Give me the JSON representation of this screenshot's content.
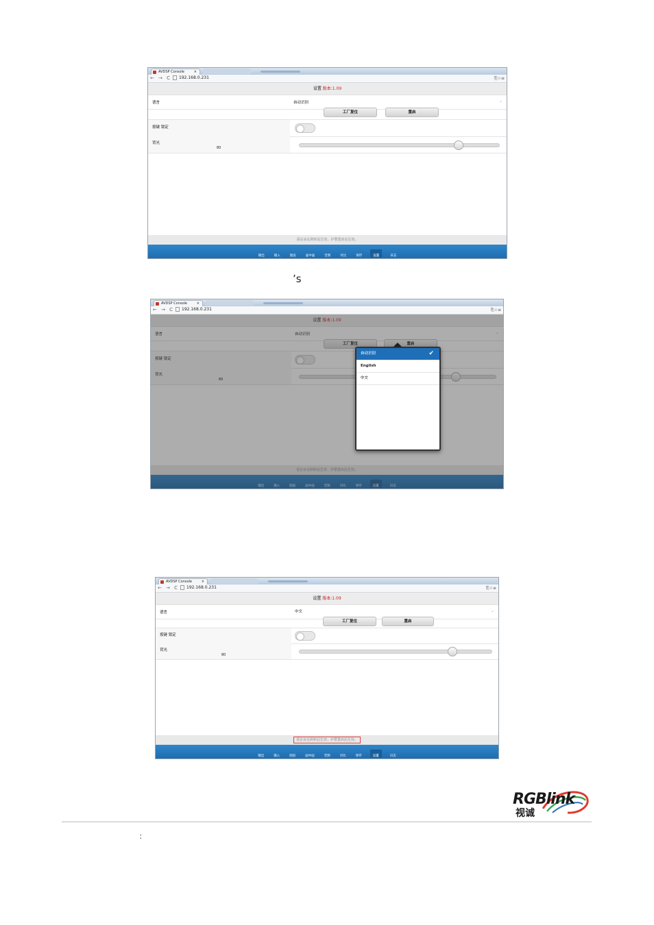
{
  "browser": {
    "tab_title": "AVDSP Console",
    "tab_close": "×",
    "nav_symbols": "← → C",
    "url": "192.168.0.231",
    "toolbar_symbols": "⎘☆≡"
  },
  "app": {
    "header_title": "设置",
    "header_version": "版本:1.09",
    "language_label": "语言",
    "language_value_auto": "自动识别",
    "language_value_cn": "中文",
    "factory_reset_label": "工厂复位",
    "restart_label": "重启",
    "key_lock_label": "按键 锁定",
    "backlight_label": "背光",
    "backlight_value": "80",
    "backlight_level": 0.8,
    "footer_hint": "语言会在刷新后生效，护要重启后生效。",
    "bottom_nav": [
      "输出",
      "输入",
      "图层",
      "画中画",
      "音频",
      "对比",
      "保存",
      "设置",
      "日志"
    ],
    "active_nav": "设置"
  },
  "language_popup": {
    "options": [
      "自动识别",
      "English",
      "中文"
    ],
    "selected": "自动识别",
    "check": "✔"
  },
  "caption_apostrophe": "’s",
  "logo": {
    "brand": "RGBlink",
    "brand_cn": "视诚"
  },
  "footer_colon": "："
}
